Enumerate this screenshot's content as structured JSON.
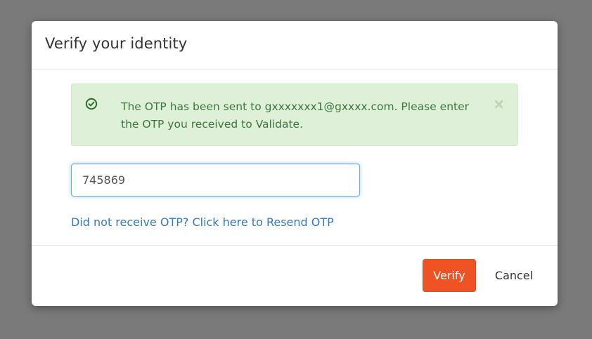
{
  "modal": {
    "title": "Verify your identity"
  },
  "alert": {
    "icon": "check-circle-icon",
    "message": "The OTP has been sent to gxxxxxxx1@gxxxx.com. Please enter the OTP you received to Validate.",
    "close_symbol": "×",
    "background_color": "#dff0d8",
    "text_color": "#3c763d"
  },
  "otp_field": {
    "value": "745869"
  },
  "resend_link": {
    "label": "Did not receive OTP? Click here to Resend OTP"
  },
  "footer": {
    "verify_label": "Verify",
    "cancel_label": "Cancel",
    "verify_color": "#ef5323"
  }
}
